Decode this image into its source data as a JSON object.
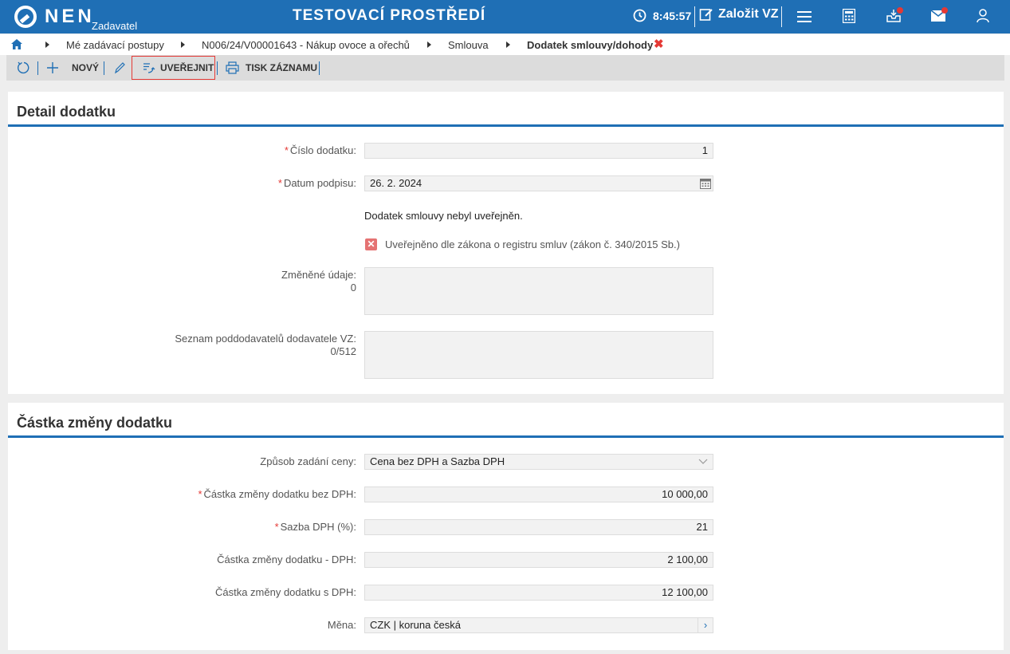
{
  "header": {
    "logo_text": "NEN",
    "logo_sub": "Zadavatel",
    "env_title": "TESTOVACÍ PROSTŘEDÍ",
    "clock": "8:45:57",
    "create_label": "Založit VZ"
  },
  "breadcrumb": {
    "items": [
      "Mé zadávací postupy",
      "N006/24/V00001643 - Nákup ovoce a ořechů",
      "Smlouva"
    ],
    "current": "Dodatek smlouvy/dohody",
    "close": "✖"
  },
  "toolbar": {
    "new_label": "NOVÝ",
    "publish_label": "UVEŘEJNIT",
    "print_label": "TISK ZÁZNAMU"
  },
  "detail": {
    "title": "Detail dodatku",
    "cislo_label": "Číslo dodatku:",
    "cislo_value": "1",
    "datum_label": "Datum podpisu:",
    "datum_value": "26. 2. 2024",
    "info_text": "Dodatek smlouvy nebyl uveřejněn.",
    "checkbox_label": "Uveřejněno dle zákona o registru smluv (zákon č. 340/2015 Sb.)",
    "zmenene_label": "Změněné údaje:",
    "zmenene_count": "0",
    "seznam_label": "Seznam poddodavatelů dodavatele VZ:",
    "seznam_count": "0/512"
  },
  "amount": {
    "title": "Částka změny dodatku",
    "zpusob_label": "Způsob zadání ceny:",
    "zpusob_value": "Cena bez DPH a Sazba DPH",
    "bez_label": "Částka změny dodatku bez DPH:",
    "bez_value": "10 000,00",
    "sazba_label": "Sazba DPH (%):",
    "sazba_value": "21",
    "dph_label": "Částka změny dodatku - DPH:",
    "dph_value": "2 100,00",
    "s_label": "Částka změny dodatku s DPH:",
    "s_value": "12 100,00",
    "mena_label": "Měna:",
    "mena_value": "CZK | koruna česká"
  },
  "colors": {
    "primary": "#1f6fb5",
    "required": "#e53935",
    "highlight": "#e53935"
  }
}
